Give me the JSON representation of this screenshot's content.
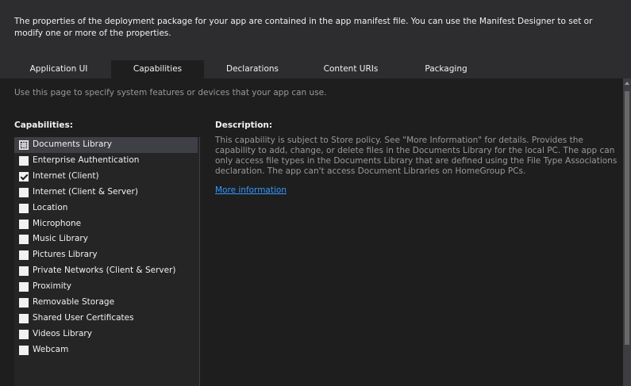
{
  "header": {
    "text": "The properties of the deployment package for your app are contained in the app manifest file. You can use the Manifest Designer to set or modify one or more of the properties."
  },
  "tabs": [
    {
      "label": "Application UI"
    },
    {
      "label": "Capabilities"
    },
    {
      "label": "Declarations"
    },
    {
      "label": "Content URIs"
    },
    {
      "label": "Packaging"
    }
  ],
  "active_tab": "Capabilities",
  "intro": "Use this page to specify system features or devices that your app can use.",
  "capabilities": {
    "title": "Capabilities:",
    "items": [
      {
        "label": "Documents Library",
        "checked": false,
        "selected": true
      },
      {
        "label": "Enterprise Authentication",
        "checked": false
      },
      {
        "label": "Internet (Client)",
        "checked": true
      },
      {
        "label": "Internet (Client & Server)",
        "checked": false
      },
      {
        "label": "Location",
        "checked": false
      },
      {
        "label": "Microphone",
        "checked": false
      },
      {
        "label": "Music Library",
        "checked": false
      },
      {
        "label": "Pictures Library",
        "checked": false
      },
      {
        "label": "Private Networks (Client & Server)",
        "checked": false
      },
      {
        "label": "Proximity",
        "checked": false
      },
      {
        "label": "Removable Storage",
        "checked": false
      },
      {
        "label": "Shared User Certificates",
        "checked": false
      },
      {
        "label": "Videos Library",
        "checked": false
      },
      {
        "label": "Webcam",
        "checked": false
      }
    ]
  },
  "description": {
    "title": "Description:",
    "text": "This capability is subject to Store policy. See \"More Information\" for details. Provides the capability to add, change, or delete files in the Documents Library for the local PC. The app can only access file types in the Documents Library that are defined using the File Type Associations declaration. The app can't access Document Libraries on HomeGroup PCs.",
    "link": "More information"
  },
  "colors": {
    "background": "#1e1e1e",
    "header_bg": "#2d2d30",
    "text": "#f1f1f1",
    "muted_text": "#999999",
    "link": "#3399ff",
    "selection": "#3f3f46"
  }
}
